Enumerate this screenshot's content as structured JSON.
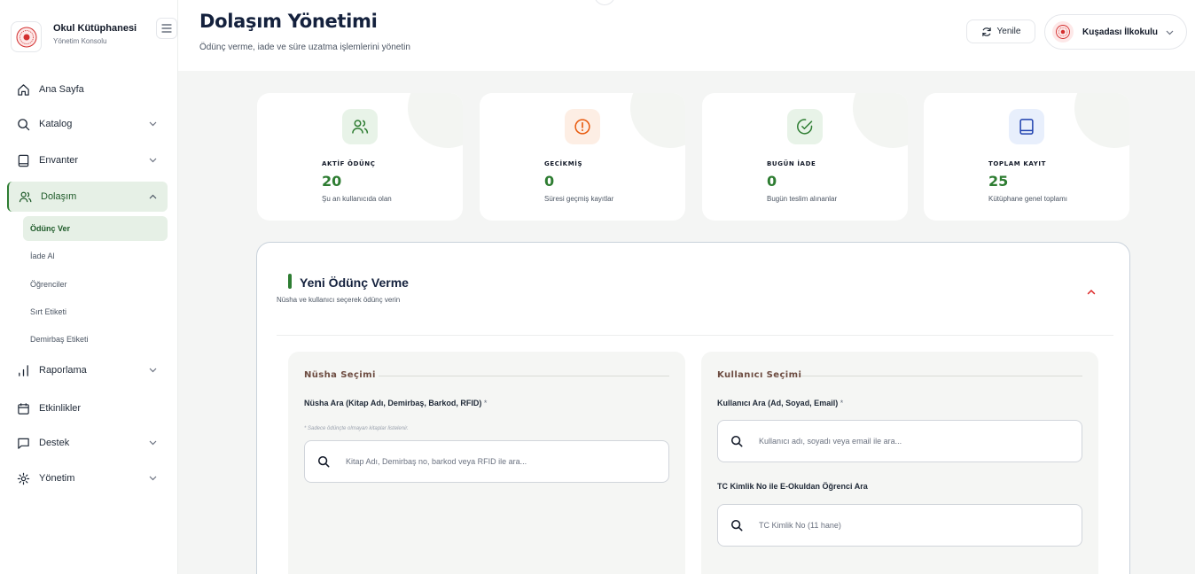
{
  "brand": {
    "title": "Okul Kütüphanesi",
    "subtitle": "Yönetim Konsolu"
  },
  "sidebar": {
    "items": [
      {
        "label": "Ana Sayfa",
        "icon": "home-icon"
      },
      {
        "label": "Katalog",
        "icon": "search-icon",
        "expandable": true
      },
      {
        "label": "Envanter",
        "icon": "book-icon",
        "expandable": true
      },
      {
        "label": "Dolaşım",
        "icon": "users-icon",
        "expandable": true,
        "expanded": true,
        "active": true
      },
      {
        "label": "Raporlama",
        "icon": "bar-chart-icon",
        "expandable": true
      },
      {
        "label": "Etkinlikler",
        "icon": "calendar-icon"
      },
      {
        "label": "Destek",
        "icon": "chat-icon",
        "expandable": true
      },
      {
        "label": "Yönetim",
        "icon": "gear-icon",
        "expandable": true
      }
    ],
    "subitems": [
      {
        "label": "Ödünç Ver",
        "active": true
      },
      {
        "label": "İade Al"
      },
      {
        "label": "Öğrenciler"
      },
      {
        "label": "Sırt Etiketi"
      },
      {
        "label": "Demirbaş Etiketi"
      }
    ]
  },
  "header": {
    "title": "Dolaşım Yönetimi",
    "subtitle": "Ödünç verme, iade ve süre uzatma işlemlerini yönetin",
    "refresh_label": "Yenile",
    "school_name": "Kuşadası İlkokulu"
  },
  "stats": [
    {
      "label": "AKTİF ÖDÜNÇ",
      "value": "20",
      "desc": "Şu an kullanıcıda olan",
      "icon": "users-icon",
      "color": "#2e7d32",
      "bg": "#e8f3e8"
    },
    {
      "label": "GECİKMİŞ",
      "value": "0",
      "desc": "Süresi geçmiş kayıtlar",
      "icon": "alert-circle-icon",
      "color": "#e8590c",
      "bg": "#fdeee4"
    },
    {
      "label": "BUGÜN İADE",
      "value": "0",
      "desc": "Bugün teslim alınanlar",
      "icon": "check-circle-icon",
      "color": "#2e7d32",
      "bg": "#e8f3e8"
    },
    {
      "label": "TOPLAM KAYIT",
      "value": "25",
      "desc": "Kütüphane genel toplamı",
      "icon": "book-icon",
      "color": "#1e40af",
      "bg": "#e8effc"
    }
  ],
  "panel": {
    "title": "Yeni Ödünç Verme",
    "subtitle": "Nüsha ve kullanıcı seçerek ödünç verin",
    "copy_section": {
      "title": "Nüsha Seçimi",
      "field_label": "Nüsha Ara (Kitap Adı, Demirbaş, Barkod, RFID)",
      "required_mark": "*",
      "hint": "* Sadece ödünçte olmayan kitaplar listelenir.",
      "search_placeholder": "Kitap Adı, Demirbaş no, barkod veya RFID ile ara...",
      "search_value": ""
    },
    "user_section": {
      "title": "Kullanıcı Seçimi",
      "field_label": "Kullanıcı Ara (Ad, Soyad, Email)",
      "required_mark": "*",
      "search_placeholder": "Kullanıcı adı, soyadı veya email ile ara...",
      "search_value": "",
      "tc_label": "TC Kimlik No ile E-Okuldan Öğrenci Ara",
      "tc_placeholder": "TC Kimlik No (11 hane)",
      "tc_value": ""
    }
  }
}
